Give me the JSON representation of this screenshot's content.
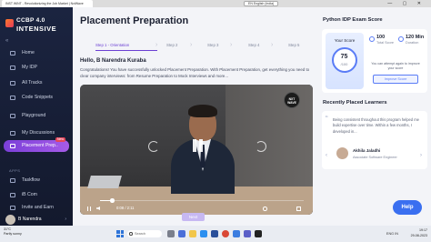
{
  "browser": {
    "tab_title": "INST WINT - Revolutionizing the Job Market | NxtWave",
    "language_selector": "EN English (India)",
    "window_controls": "— ▢ ✕"
  },
  "sidebar": {
    "logo_line1": "CCBP 4.0",
    "logo_line2": "INTENSIVE",
    "items": [
      {
        "label": "Home"
      },
      {
        "label": "My IDP"
      },
      {
        "label": "All Tracks"
      },
      {
        "label": "Code Snippets"
      },
      {
        "label": "Playground"
      },
      {
        "label": "My Discussions"
      },
      {
        "label": "Placement Prep..",
        "badge": "New"
      }
    ],
    "apps_label": "APPS",
    "apps": [
      {
        "label": "Taskflow"
      },
      {
        "label": "iB Com"
      },
      {
        "label": "Invite and Earn"
      }
    ],
    "user_name": "B Narendra"
  },
  "main": {
    "title": "Placement Preparation",
    "steps": [
      {
        "label": "Step 1 - Orientation"
      },
      {
        "label": "Step 2"
      },
      {
        "label": "Step 3"
      },
      {
        "label": "Step 4"
      },
      {
        "label": "Step 5"
      }
    ],
    "greeting": "Hello, B Narendra Kuraba",
    "intro": "Congratulations! You have successfully unlocked Placement Preparation. With Placement Preparation, get everything you need to clear company interviews: from Resume Preparation to Mock Interviews and more...",
    "video": {
      "badge": "NXT WAVE",
      "time": "0:08 / 2:11",
      "progress": 0.06
    },
    "next_label": "Next"
  },
  "right": {
    "exam_title": "Python IDP Exam Score",
    "your_score_label": "Your Score",
    "score": "75",
    "score_max": "/100",
    "total_score_value": "100",
    "total_score_label": "Total Score",
    "time_value": "120 Min",
    "time_label": "Duration",
    "improve_text": "You can attempt again to improve your score",
    "improve_button": "Improve Score",
    "learners_title": "Recently Placed Learners",
    "quote": "Being consistent throughout this program helped me build expertise over time. Within a few months, I developed in...",
    "learner_name": "Akhila Jaladhi",
    "learner_role": "Associate Software Engineer",
    "help_label": "Help"
  },
  "taskbar": {
    "weather_temp": "31°C",
    "weather_desc": "Partly sunny",
    "search_placeholder": "Search",
    "time": "19:17",
    "date": "29-08-2023",
    "tray_lang": "ENG IN"
  },
  "colors": {
    "sidebar_bg": "#1b2440",
    "accent_purple": "#7a3fd8",
    "accent_blue": "#3a6ff0",
    "badge_red": "#e3465a"
  }
}
